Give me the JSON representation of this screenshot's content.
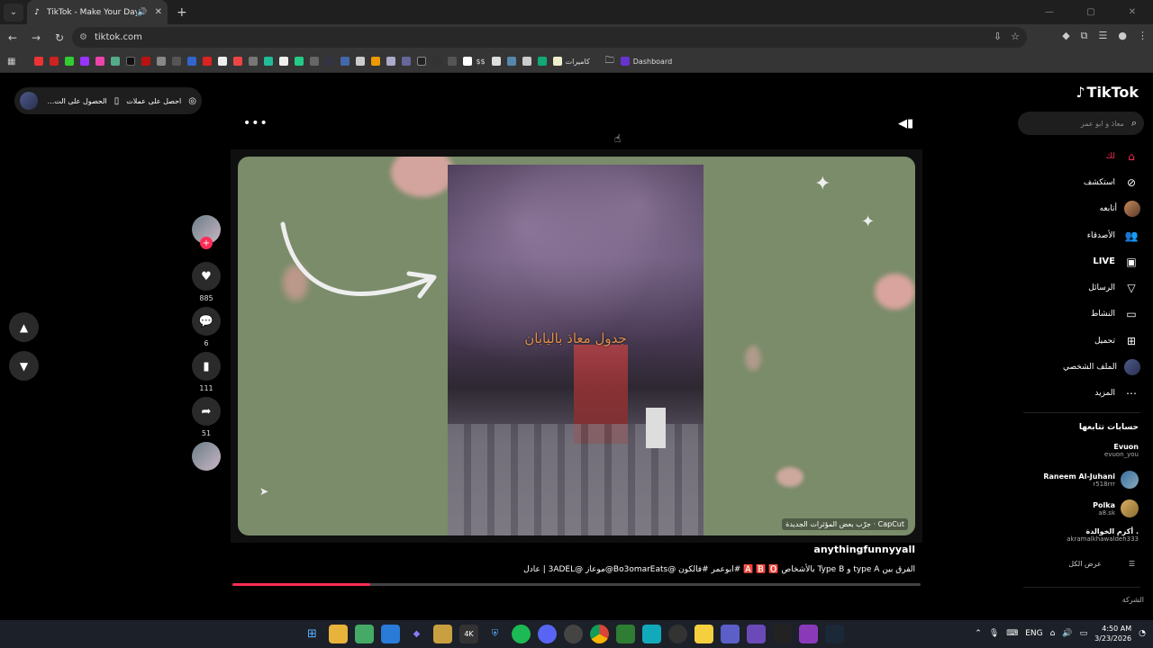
{
  "browser": {
    "tab_title": "TikTok - Make Your Day",
    "url": "tiktok.com",
    "bookmarks_text": [
      "$$",
      "كاميرات",
      "Dashboard"
    ]
  },
  "page": {
    "promo_left": "الحصول على الت...",
    "promo_right": "احصل على عملات",
    "video": {
      "overlay_text": "جدول معاذ باليابان",
      "capcut_label": "CapCut · جرّب بعض المؤثرات الجديدة",
      "author": "anythingfunnyyall",
      "caption": "الفرق بين type A و Type B بالأشخاص 🅰️ 🅱️ 🅾️ #ابوعمر #فالكون @Bo3omarEats@موعاز @3ADEL | عادل",
      "progress_percent": 20
    },
    "rail": {
      "likes": "885",
      "comments": "6",
      "saves": "111",
      "shares": "51"
    }
  },
  "sidebar": {
    "logo": "TikTok",
    "search_placeholder": "معاذ و ابو عمر",
    "menu": [
      {
        "label": "لك"
      },
      {
        "label": "استكشف"
      },
      {
        "label": "أتابعه"
      },
      {
        "label": "الأصدقاء"
      },
      {
        "label": "LIVE"
      },
      {
        "label": "الرسائل"
      },
      {
        "label": "النشاط"
      },
      {
        "label": "تحميل"
      },
      {
        "label": "الملف الشخصي"
      },
      {
        "label": "المزيد"
      }
    ],
    "following_title": "حسابات تتابعها",
    "following": [
      {
        "name": "Evuon",
        "handle": "evuon_you"
      },
      {
        "name": "Raneem Al-Juhani",
        "handle": "r518rrr"
      },
      {
        "name": "Polka",
        "handle": "a8.sk"
      },
      {
        "name": "أكرم الخوالدة .",
        "handle": "akramalkhawaldeh333"
      }
    ],
    "see_all": "عرض الكل",
    "company": "الشركة"
  },
  "taskbar": {
    "lang": "ENG",
    "time": "4:50 AM",
    "date": "3/23/2026"
  }
}
